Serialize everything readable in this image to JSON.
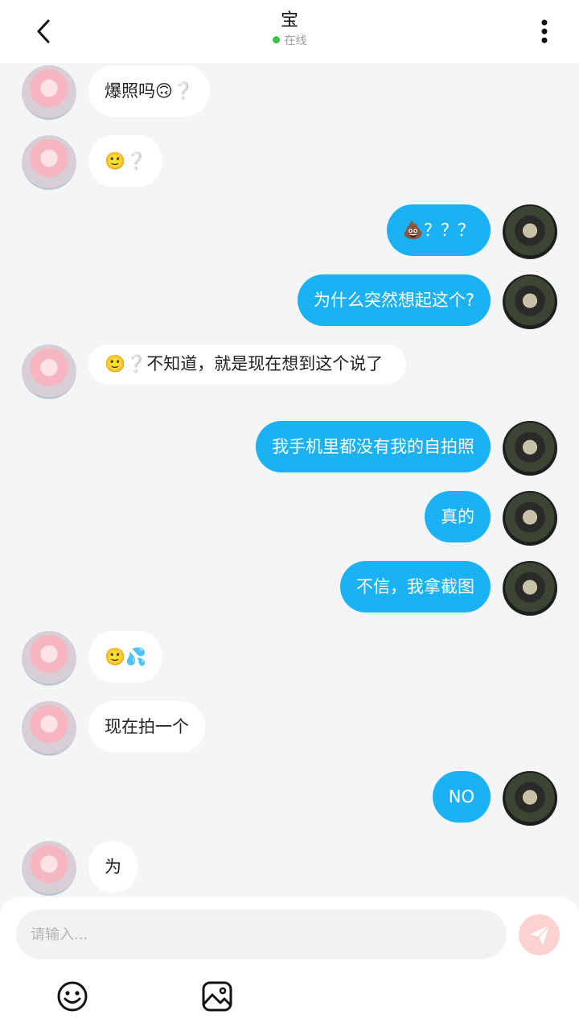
{
  "header": {
    "title": "宝",
    "status": "在线"
  },
  "messages": [
    {
      "side": "in",
      "text": "爆照吗🙃❔"
    },
    {
      "side": "in",
      "text": "🙂❔"
    },
    {
      "side": "out",
      "text": "💩？？？"
    },
    {
      "side": "out",
      "text": "为什么突然想起这个?"
    },
    {
      "side": "in",
      "text": "🙂❔不知道，就是现在想到这个说了"
    },
    {
      "side": "out",
      "text": "我手机里都没有我的自拍照"
    },
    {
      "side": "out",
      "text": "真的"
    },
    {
      "side": "out",
      "text": "不信，我拿截图"
    },
    {
      "side": "in",
      "text": "🙂💦"
    },
    {
      "side": "in",
      "text": "现在拍一个"
    },
    {
      "side": "out",
      "text": "NO"
    },
    {
      "side": "in",
      "text": "为"
    }
  ],
  "composer": {
    "placeholder": "请输入..."
  },
  "icons": {
    "back": "back-arrow-icon",
    "more": "more-vertical-icon",
    "send": "send-icon",
    "emoji": "emoji-icon",
    "image": "image-icon"
  },
  "colors": {
    "outgoing_bubble": "#1ab2f5",
    "incoming_bubble": "#ffffff",
    "online_dot": "#35c54d",
    "send_button": "#fcd3d1"
  }
}
